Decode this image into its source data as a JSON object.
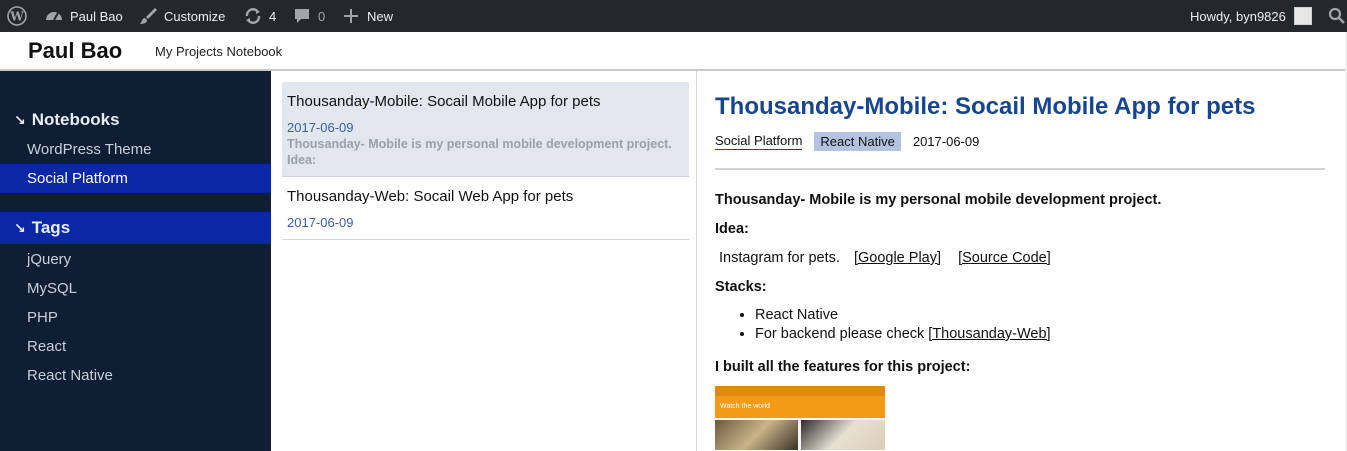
{
  "adminbar": {
    "site_name": "Paul Bao",
    "customize": "Customize",
    "updates_count": "4",
    "comments_count": "0",
    "new_label": "New",
    "howdy": "Howdy, byn9826"
  },
  "header": {
    "title": "Paul Bao",
    "description": "My Projects Notebook"
  },
  "sidebar": {
    "notebooks_title": "Notebooks",
    "notebooks": [
      {
        "label": "WordPress Theme"
      },
      {
        "label": "Social Platform"
      }
    ],
    "tags_title": "Tags",
    "tags": [
      {
        "label": "jQuery"
      },
      {
        "label": "MySQL"
      },
      {
        "label": "PHP"
      },
      {
        "label": "React"
      },
      {
        "label": "React Native"
      }
    ]
  },
  "list": [
    {
      "title": "Thousanday-Mobile: Socail Mobile App for pets",
      "date": "2017-06-09",
      "excerpt_line1": "Thousanday- Mobile is my personal mobile development project.",
      "excerpt_line2": "Idea:"
    },
    {
      "title": "Thousanday-Web: Socail Web App for pets",
      "date": "2017-06-09"
    }
  ],
  "post": {
    "title": "Thousanday-Mobile: Socail Mobile App for pets",
    "notebook": "Social Platform",
    "tag": "React Native",
    "date": "2017-06-09",
    "intro": "Thousanday- Mobile is my personal mobile development project.",
    "idea_heading": "Idea:",
    "idea_text": "Instagram for pets.",
    "google_play": "[Google Play]",
    "source_code": "[Source Code]",
    "stacks_heading": "Stacks:",
    "stack_item1": "React Native",
    "stack_item2_text": "For backend please check",
    "stack_item2_link": "[Thousanday-Web]",
    "features_heading": "I built all the features for this project:",
    "shot_bar": "Watch the world"
  },
  "colors": {
    "adminbar_bg": "#23282d",
    "sidebar_bg": "#0f1e33",
    "accent_blue": "#0a27a6",
    "title_blue": "#17468f"
  }
}
